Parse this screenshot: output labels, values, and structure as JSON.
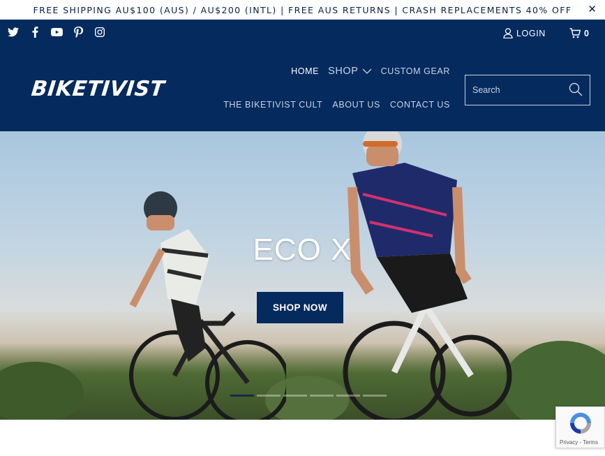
{
  "announcement": {
    "text": "FREE SHIPPING AU$100 (AUS) / AU$200 (INTL) | FREE AUS RETURNS | CRASH REPLACEMENTS 40% OFF",
    "close": "✕"
  },
  "social": [
    "twitter-icon",
    "facebook-icon",
    "youtube-icon",
    "pinterest-icon",
    "instagram-icon"
  ],
  "account": {
    "login": "LOGIN",
    "cart_count": "0"
  },
  "logo": "BIKETIVIST",
  "nav": {
    "home": "HOME",
    "shop": "SHOP",
    "custom_gear": "CUSTOM GEAR",
    "cult": "THE BIKETIVIST CULT",
    "about": "ABOUT US",
    "contact": "CONTACT US"
  },
  "search": {
    "placeholder": "Search"
  },
  "hero": {
    "title": "ECO X",
    "button": "SHOP NOW"
  },
  "recaptcha": {
    "terms": "Privacy - Terms"
  },
  "colors": {
    "brand_navy": "#042a5e",
    "announcement_text": "#0b2048"
  }
}
